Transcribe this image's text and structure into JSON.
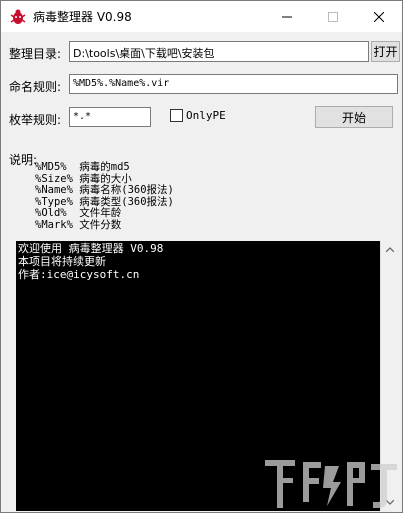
{
  "window": {
    "title": "病毒整理器 V0.98"
  },
  "form": {
    "dir_label": "整理目录:",
    "dir_value": "D:\\tools\\桌面\\下载吧\\安装包",
    "open_button": "打开",
    "naming_label": "命名规则:",
    "naming_value": "%MD5%.%Name%.vir",
    "enum_label": "枚举规则:",
    "enum_value": "*.*",
    "onlype_label": "OnlyPE",
    "onlype_checked": false,
    "start_button": "开始"
  },
  "description": {
    "title": "说明:",
    "items": [
      "%MD5%  病毒的md5",
      "%Size% 病毒的大小",
      "%Name% 病毒名称(360报法)",
      "%Type% 病毒类型(360报法)",
      "%Old%  文件年龄",
      "%Mark% 文件分数"
    ]
  },
  "console": {
    "lines": [
      "欢迎使用 病毒整理器 V0.98",
      "本项目将持续更新",
      "作者:ice@icysoft.cn"
    ]
  },
  "colors": {
    "console_bg": "#000000",
    "console_fg": "#ffffff",
    "window_bg": "#f0f0f0"
  }
}
